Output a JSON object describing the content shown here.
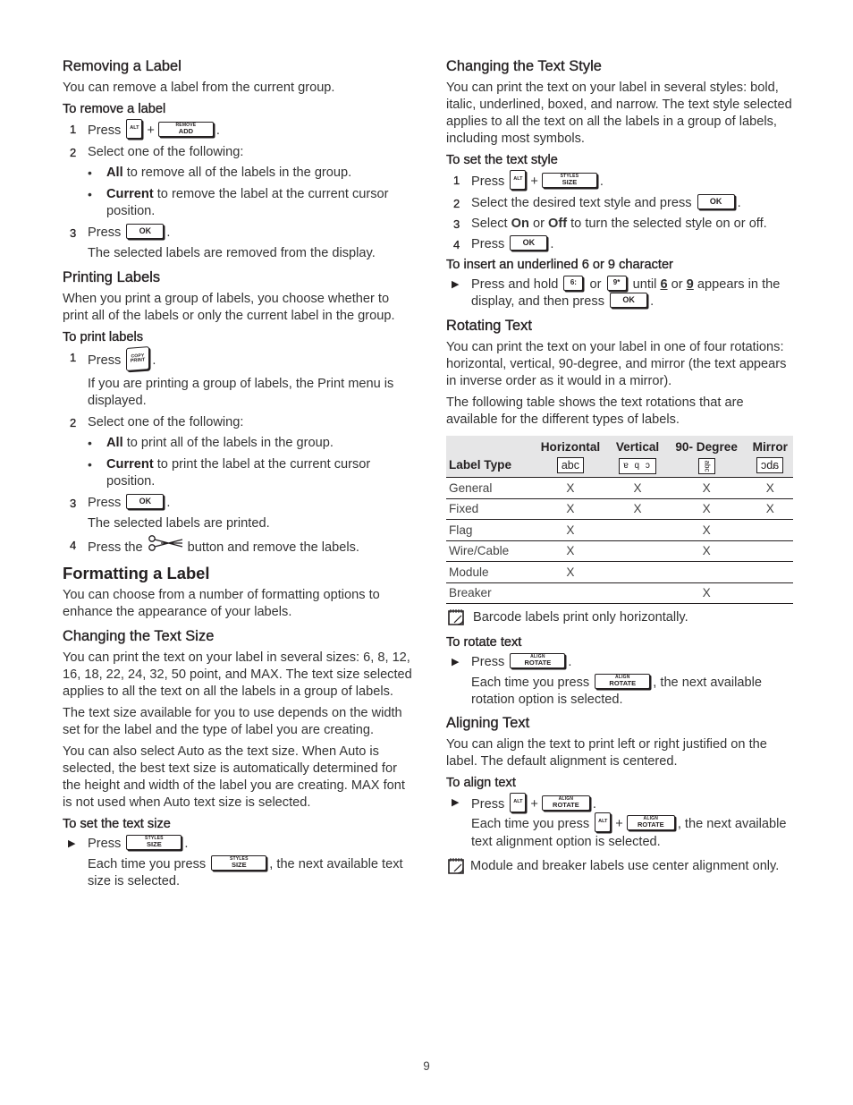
{
  "page_number": "9",
  "keys": {
    "alt": "ALT",
    "remove_add": {
      "top": "REMOVE",
      "bottom": "ADD"
    },
    "ok": "OK",
    "copy_print": {
      "top": "COPY",
      "bottom": "PRINT"
    },
    "styles_size": {
      "top": "STYLES",
      "bottom": "SIZE"
    },
    "align_rotate": {
      "top": "ALIGN",
      "bottom": "ROTATE"
    },
    "six": "6:",
    "nine": "9*",
    "icons": {
      "cut": "scissors-icon",
      "note": "note-pad-icon",
      "step_arrow": "triangle-right-icon"
    }
  },
  "left": {
    "removing": {
      "title": "Removing a Label",
      "intro": "You can remove a label from the current group.",
      "procedure": "To remove a label",
      "step1_prefix": "Press",
      "step2": "Select one of the following:",
      "bullet1_bold": "All",
      "bullet1_rest": " to remove all of the labels in the group.",
      "bullet2_bold": "Current",
      "bullet2_rest": " to remove the label at the current cursor position.",
      "step3_prefix": "Press",
      "result": "The selected labels are removed from the display."
    },
    "printing": {
      "title": "Printing Labels",
      "intro": "When you print a group of labels, you choose whether to print all of the labels or only the current label in the group.",
      "procedure": "To print labels",
      "step1_prefix": "Press",
      "step1_note": "If you are printing a group of labels, the Print menu is displayed.",
      "step2": "Select one of the following:",
      "bullet1_bold": "All",
      "bullet1_rest": " to print all of the labels in the group.",
      "bullet2_bold": "Current",
      "bullet2_rest": " to print the label at the current cursor position.",
      "step3_prefix": "Press",
      "result": "The selected labels are printed.",
      "step4_prefix": "Press the",
      "step4_suffix": "button and remove the labels."
    },
    "formatting": {
      "title": "Formatting a Label",
      "intro": "You can choose from a number of formatting options to enhance the appearance of your labels."
    },
    "text_size": {
      "title": "Changing the Text Size",
      "para1": "You can print the text on your label in several sizes: 6, 8, 12, 16, 18, 22, 24, 32, 50 point, and MAX. The text size selected applies to all the text on all the labels in a group of labels.",
      "para2": "The text size available for you to use depends on the width set for the label and the type of label you are creating.",
      "para3": "You can also select Auto as the text size. When Auto is selected, the best text size is automatically determined for the height and width of the label you are creating. MAX font is not used when Auto text size is selected.",
      "procedure": "To set the text size",
      "step_prefix": "Press",
      "each_prefix": "Each time you press",
      "each_suffix": ", the next available text size is selected."
    }
  },
  "right": {
    "text_style": {
      "title": "Changing the Text Style",
      "intro": "You can print the text on your label in several styles: bold, italic, underlined, boxed, and narrow. The text style selected applies to all the text on all the labels in a group of labels, including most symbols.",
      "procedure": "To set the text style",
      "step1_prefix": "Press",
      "step2_prefix": "Select the desired text style and press",
      "step3_a": "Select ",
      "step3_on": "On",
      "step3_b": " or ",
      "step3_off": "Off",
      "step3_c": " to turn the selected style on or off.",
      "step4_prefix": "Press",
      "underline_procedure": "To insert an underlined 6 or 9 character",
      "ul_a": "Press and hold",
      "ul_or": "or",
      "ul_until": "until",
      "ul_six": "6",
      "ul_or2": "or",
      "ul_nine": "9",
      "ul_b": "appears in the display, and then press"
    },
    "rotating": {
      "title": "Rotating Text",
      "para1": "You can print the text on your label in one of four rotations: horizontal, vertical, 90-degree, and mirror (the text appears in inverse order as it would in a mirror).",
      "para2": "The following table shows the text rotations that are available for the different types of labels.",
      "table": {
        "label_type_header": "Label Type",
        "columns": [
          {
            "name": "Horizontal",
            "sample": "abc"
          },
          {
            "name": "Vertical",
            "sample": "abc"
          },
          {
            "name": "90- Degree",
            "sample": "abc"
          },
          {
            "name": "Mirror",
            "sample": "abc"
          }
        ],
        "rows": [
          {
            "type": "General",
            "values": [
              "X",
              "X",
              "X",
              "X"
            ]
          },
          {
            "type": "Fixed",
            "values": [
              "X",
              "X",
              "X",
              "X"
            ]
          },
          {
            "type": "Flag",
            "values": [
              "X",
              "",
              "X",
              ""
            ]
          },
          {
            "type": "Wire/Cable",
            "values": [
              "X",
              "",
              "X",
              ""
            ]
          },
          {
            "type": "Module",
            "values": [
              "X",
              "",
              "",
              ""
            ]
          },
          {
            "type": "Breaker",
            "values": [
              "",
              "",
              "X",
              ""
            ]
          }
        ]
      },
      "note": "Barcode labels print only horizontally.",
      "procedure": "To rotate text",
      "step_prefix": "Press",
      "each_prefix": "Each time you press",
      "each_suffix": ", the next available rotation option is selected."
    },
    "aligning": {
      "title": "Aligning Text",
      "intro": "You can align the text to print left or right justified on the label. The default alignment is centered.",
      "procedure": "To align text",
      "step_prefix": "Press",
      "each_prefix": "Each time you press",
      "each_suffix": ", the next available text alignment option is selected.",
      "note": "Module and breaker labels use center alignment only."
    }
  }
}
